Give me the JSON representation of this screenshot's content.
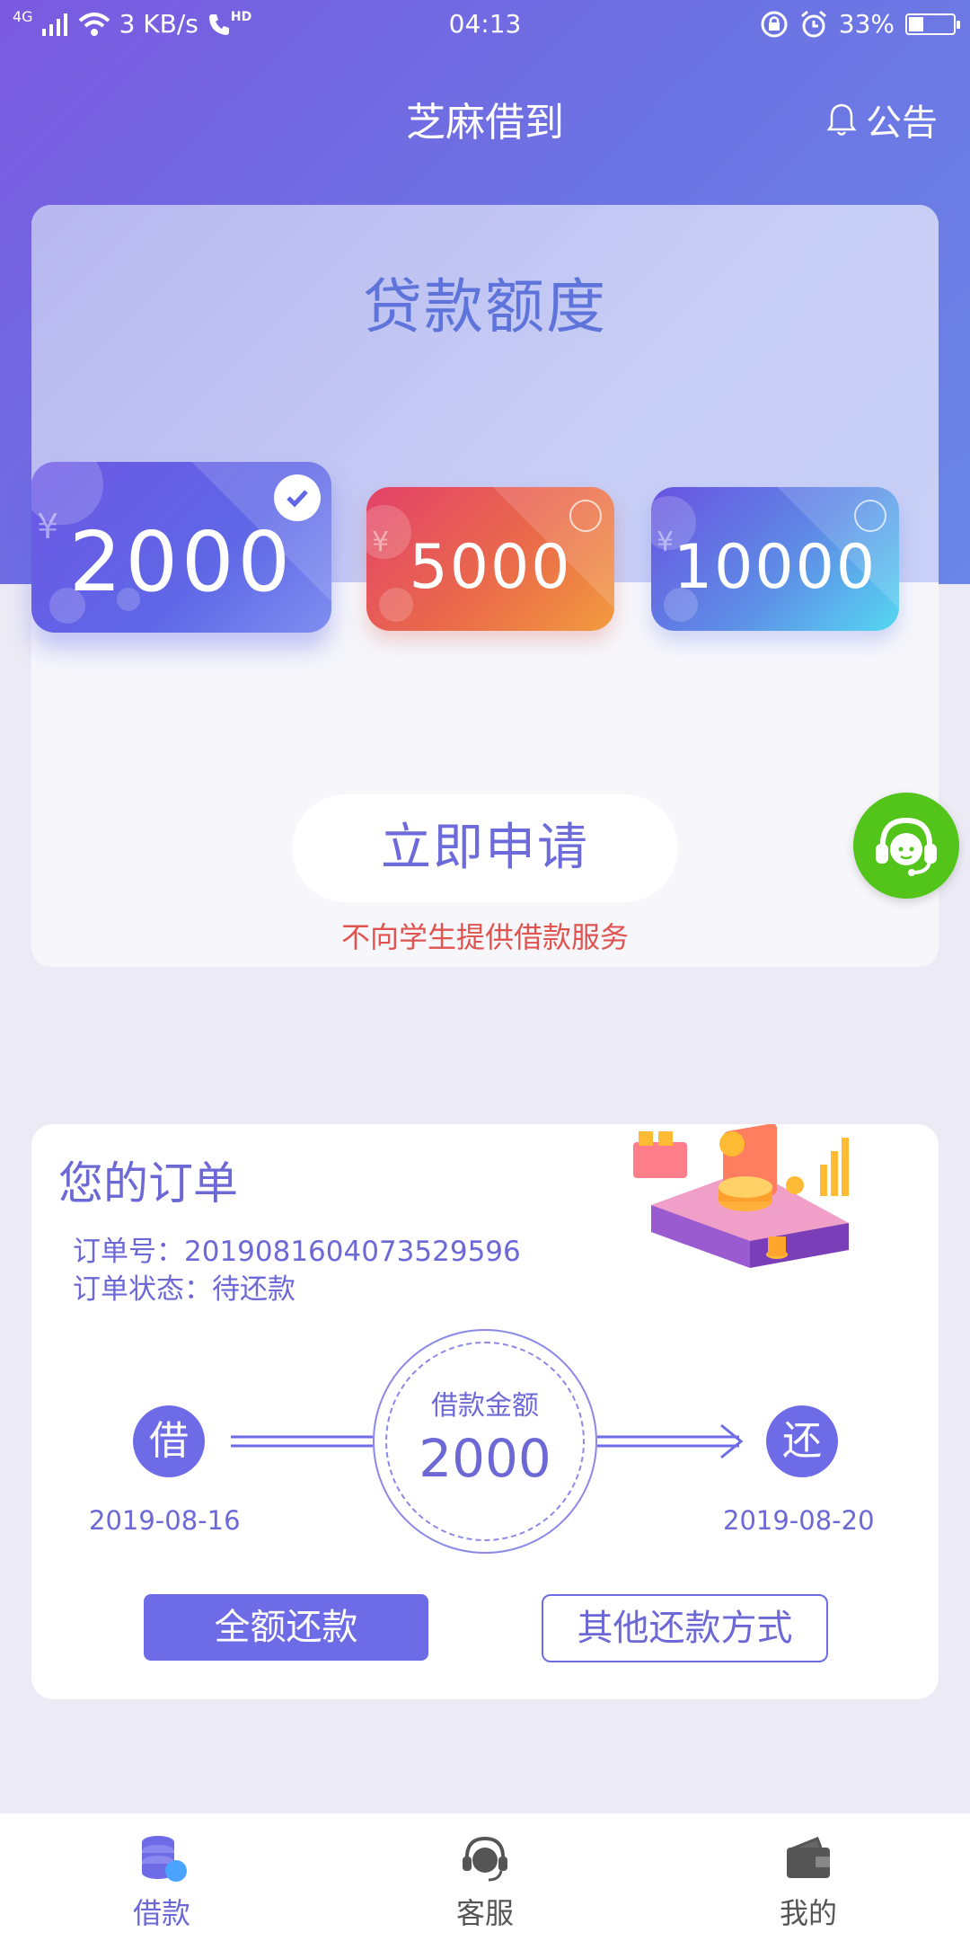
{
  "status_bar": {
    "network": "4G",
    "speed": "3 KB/s",
    "hd": "HD",
    "time": "04:13",
    "battery": "33%",
    "battery_level": 0.33
  },
  "header": {
    "title": "芝麻借到",
    "notice_label": "公告"
  },
  "loan": {
    "title": "贷款额度",
    "amounts": [
      {
        "value": "2000",
        "selected": true
      },
      {
        "value": "5000",
        "selected": false
      },
      {
        "value": "10000",
        "selected": false
      }
    ],
    "yen": "¥",
    "apply_label": "立即申请",
    "note": "不向学生提供借款服务"
  },
  "order": {
    "title": "您的订单",
    "number_line": "订单号：2019081604073529596",
    "status_line": "订单状态：待还款",
    "borrow_char": "借",
    "return_char": "还",
    "borrow_date": "2019-08-16",
    "return_date": "2019-08-20",
    "amount_label": "借款金额",
    "amount": "2000",
    "full_repay_label": "全额还款",
    "other_repay_label": "其他还款方式"
  },
  "nav": {
    "items": [
      {
        "label": "借款",
        "active": true,
        "icon": "coins-icon"
      },
      {
        "label": "客服",
        "active": false,
        "icon": "headset-icon"
      },
      {
        "label": "我的",
        "active": false,
        "icon": "wallet-icon"
      }
    ]
  },
  "colors": {
    "accent": "#6e6be6",
    "warning": "#e0534f",
    "service_green": "#52c41a"
  }
}
